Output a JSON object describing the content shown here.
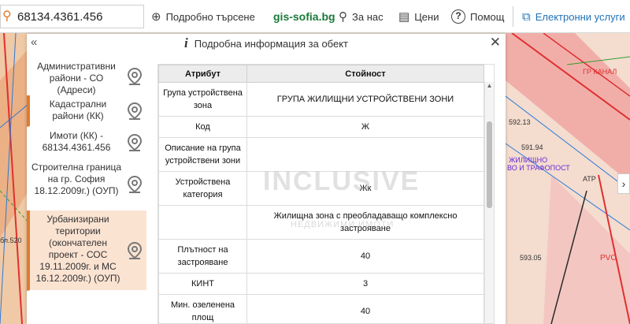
{
  "topbar": {
    "search_value": "68134.4361.456",
    "detailed_search_label": "Подробно търсене",
    "logo": "gis-sofia.bg",
    "about_label": "За нас",
    "prices_label": "Цени",
    "help_label": "Помощ",
    "eservices_label": "Електронни услуги"
  },
  "panel": {
    "title": "Подробна информация за обект",
    "layers": [
      {
        "label": "Административни райони - СО (Адреси)"
      },
      {
        "label": "Кадастрални райони (КК)"
      },
      {
        "label": "Имоти (КК) - 68134.4361.456"
      },
      {
        "label": "Строителна граница на гр. София 18.12.2009г.) (ОУП)"
      },
      {
        "label": "Урбанизирани територии (окончателен проект - СОС 19.11.2009г. и МС 16.12.2009г.) (ОУП)"
      }
    ],
    "table": {
      "headers": [
        "Атрибут",
        "Стойност"
      ],
      "rows": [
        {
          "attr": "Група устройствена зона",
          "value": "ГРУПА ЖИЛИЩНИ УСТРОЙСТВЕНИ ЗОНИ"
        },
        {
          "attr": "Код",
          "value": "Ж"
        },
        {
          "attr": "Описание на група устройствени зони",
          "value": ""
        },
        {
          "attr": "Устройствена категория",
          "value": "Жк"
        },
        {
          "attr": "",
          "value": "Жилищна зона с преобладаващо комплексно застрояване"
        },
        {
          "attr": "Плътност на застрояване",
          "value": "40"
        },
        {
          "attr": "КИНТ",
          "value": "3"
        },
        {
          "attr": "Мин. озеленена площ",
          "value": "40"
        }
      ]
    }
  },
  "watermark": {
    "main": "INCLUSIVE",
    "sub": "НЕДВИЖИМИ ИМОТИ"
  },
  "map_labels": [
    "592.13",
    "591.94",
    "593.05",
    "ЖИЛИЩНО",
    "ВО И ТРАФОПОСТ",
    "АТР",
    "РVС",
    "ГР КАНАЛ",
    "бл.520"
  ],
  "colors": {
    "accent": "#e07a2a",
    "link": "#1f72b8",
    "logo": "#1a7a3a",
    "active_layer": "#fbe3d2"
  }
}
